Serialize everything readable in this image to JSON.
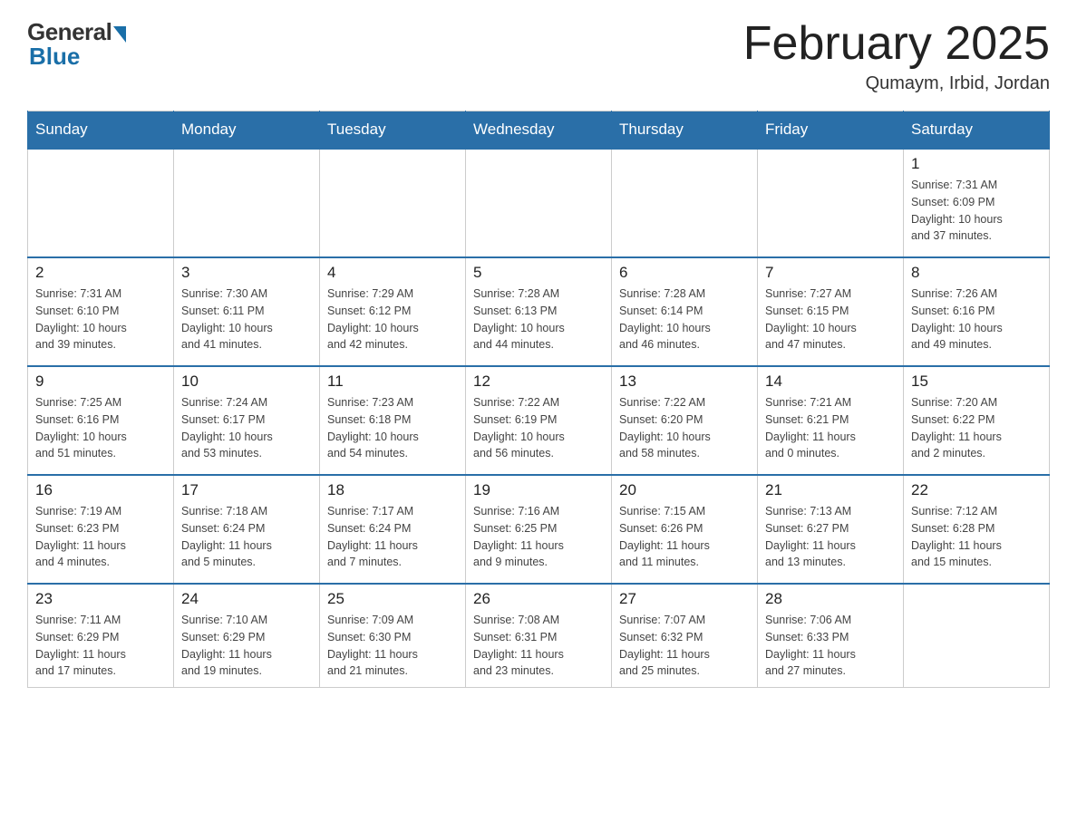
{
  "logo": {
    "general": "General",
    "blue": "Blue"
  },
  "title": {
    "month_year": "February 2025",
    "location": "Qumaym, Irbid, Jordan"
  },
  "weekdays": [
    "Sunday",
    "Monday",
    "Tuesday",
    "Wednesday",
    "Thursday",
    "Friday",
    "Saturday"
  ],
  "weeks": [
    [
      {
        "day": "",
        "info": ""
      },
      {
        "day": "",
        "info": ""
      },
      {
        "day": "",
        "info": ""
      },
      {
        "day": "",
        "info": ""
      },
      {
        "day": "",
        "info": ""
      },
      {
        "day": "",
        "info": ""
      },
      {
        "day": "1",
        "info": "Sunrise: 7:31 AM\nSunset: 6:09 PM\nDaylight: 10 hours\nand 37 minutes."
      }
    ],
    [
      {
        "day": "2",
        "info": "Sunrise: 7:31 AM\nSunset: 6:10 PM\nDaylight: 10 hours\nand 39 minutes."
      },
      {
        "day": "3",
        "info": "Sunrise: 7:30 AM\nSunset: 6:11 PM\nDaylight: 10 hours\nand 41 minutes."
      },
      {
        "day": "4",
        "info": "Sunrise: 7:29 AM\nSunset: 6:12 PM\nDaylight: 10 hours\nand 42 minutes."
      },
      {
        "day": "5",
        "info": "Sunrise: 7:28 AM\nSunset: 6:13 PM\nDaylight: 10 hours\nand 44 minutes."
      },
      {
        "day": "6",
        "info": "Sunrise: 7:28 AM\nSunset: 6:14 PM\nDaylight: 10 hours\nand 46 minutes."
      },
      {
        "day": "7",
        "info": "Sunrise: 7:27 AM\nSunset: 6:15 PM\nDaylight: 10 hours\nand 47 minutes."
      },
      {
        "day": "8",
        "info": "Sunrise: 7:26 AM\nSunset: 6:16 PM\nDaylight: 10 hours\nand 49 minutes."
      }
    ],
    [
      {
        "day": "9",
        "info": "Sunrise: 7:25 AM\nSunset: 6:16 PM\nDaylight: 10 hours\nand 51 minutes."
      },
      {
        "day": "10",
        "info": "Sunrise: 7:24 AM\nSunset: 6:17 PM\nDaylight: 10 hours\nand 53 minutes."
      },
      {
        "day": "11",
        "info": "Sunrise: 7:23 AM\nSunset: 6:18 PM\nDaylight: 10 hours\nand 54 minutes."
      },
      {
        "day": "12",
        "info": "Sunrise: 7:22 AM\nSunset: 6:19 PM\nDaylight: 10 hours\nand 56 minutes."
      },
      {
        "day": "13",
        "info": "Sunrise: 7:22 AM\nSunset: 6:20 PM\nDaylight: 10 hours\nand 58 minutes."
      },
      {
        "day": "14",
        "info": "Sunrise: 7:21 AM\nSunset: 6:21 PM\nDaylight: 11 hours\nand 0 minutes."
      },
      {
        "day": "15",
        "info": "Sunrise: 7:20 AM\nSunset: 6:22 PM\nDaylight: 11 hours\nand 2 minutes."
      }
    ],
    [
      {
        "day": "16",
        "info": "Sunrise: 7:19 AM\nSunset: 6:23 PM\nDaylight: 11 hours\nand 4 minutes."
      },
      {
        "day": "17",
        "info": "Sunrise: 7:18 AM\nSunset: 6:24 PM\nDaylight: 11 hours\nand 5 minutes."
      },
      {
        "day": "18",
        "info": "Sunrise: 7:17 AM\nSunset: 6:24 PM\nDaylight: 11 hours\nand 7 minutes."
      },
      {
        "day": "19",
        "info": "Sunrise: 7:16 AM\nSunset: 6:25 PM\nDaylight: 11 hours\nand 9 minutes."
      },
      {
        "day": "20",
        "info": "Sunrise: 7:15 AM\nSunset: 6:26 PM\nDaylight: 11 hours\nand 11 minutes."
      },
      {
        "day": "21",
        "info": "Sunrise: 7:13 AM\nSunset: 6:27 PM\nDaylight: 11 hours\nand 13 minutes."
      },
      {
        "day": "22",
        "info": "Sunrise: 7:12 AM\nSunset: 6:28 PM\nDaylight: 11 hours\nand 15 minutes."
      }
    ],
    [
      {
        "day": "23",
        "info": "Sunrise: 7:11 AM\nSunset: 6:29 PM\nDaylight: 11 hours\nand 17 minutes."
      },
      {
        "day": "24",
        "info": "Sunrise: 7:10 AM\nSunset: 6:29 PM\nDaylight: 11 hours\nand 19 minutes."
      },
      {
        "day": "25",
        "info": "Sunrise: 7:09 AM\nSunset: 6:30 PM\nDaylight: 11 hours\nand 21 minutes."
      },
      {
        "day": "26",
        "info": "Sunrise: 7:08 AM\nSunset: 6:31 PM\nDaylight: 11 hours\nand 23 minutes."
      },
      {
        "day": "27",
        "info": "Sunrise: 7:07 AM\nSunset: 6:32 PM\nDaylight: 11 hours\nand 25 minutes."
      },
      {
        "day": "28",
        "info": "Sunrise: 7:06 AM\nSunset: 6:33 PM\nDaylight: 11 hours\nand 27 minutes."
      },
      {
        "day": "",
        "info": ""
      }
    ]
  ]
}
